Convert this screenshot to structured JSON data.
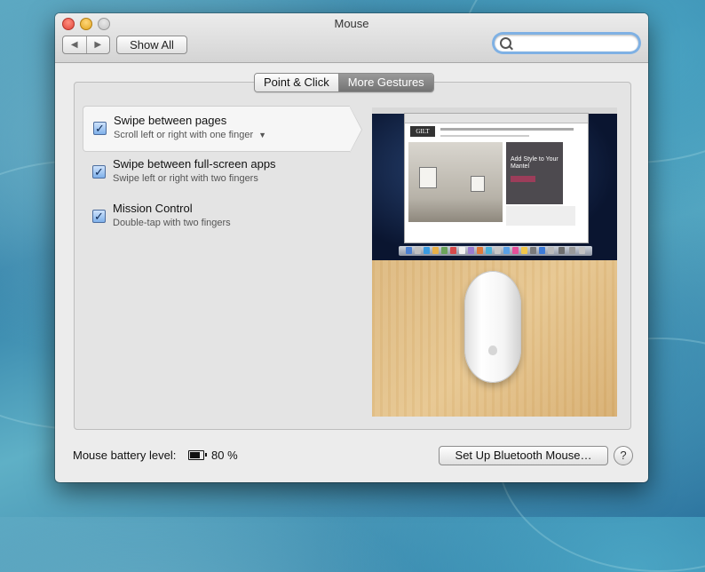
{
  "window": {
    "title": "Mouse"
  },
  "toolbar": {
    "back_icon": "chevron-left-icon",
    "forward_icon": "chevron-right-icon",
    "show_all_label": "Show All",
    "search_value": "",
    "search_placeholder": ""
  },
  "tabs": [
    {
      "label": "Point & Click",
      "active": false
    },
    {
      "label": "More Gestures",
      "active": true
    }
  ],
  "gestures": [
    {
      "title": "Swipe between pages",
      "subtitle": "Scroll left or right with one finger",
      "checked": true,
      "selected": true,
      "has_dropdown": true
    },
    {
      "title": "Swipe between full-screen apps",
      "subtitle": "Swipe left or right with two fingers",
      "checked": true,
      "selected": false,
      "has_dropdown": false
    },
    {
      "title": "Mission Control",
      "subtitle": "Double-tap with two fingers",
      "checked": true,
      "selected": false,
      "has_dropdown": false
    }
  ],
  "preview": {
    "site_logo": "GILT",
    "ad_headline": "Add Style to Your Mantel"
  },
  "footer": {
    "battery_label": "Mouse battery level:",
    "battery_value": "80 %",
    "battery_level": 0.8,
    "setup_button_label": "Set Up Bluetooth Mouse…",
    "help_label": "?"
  },
  "colors": {
    "accent_focus": "#7fb1e4",
    "active_tab": "#7f7f7f",
    "checkbox": "#7fb0ea"
  }
}
